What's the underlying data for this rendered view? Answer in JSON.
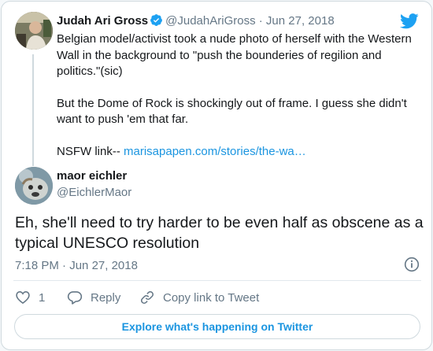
{
  "parent_tweet": {
    "author_name": "Judah Ari Gross",
    "handle": "@JudahAriGross",
    "separator": "·",
    "date": "Jun 27, 2018",
    "paragraphs": [
      "Belgian model/activist took a nude photo of herself with the Western Wall in the background to \"push the bounderies of regilion and politics.\"(sic)",
      "But the Dome of Rock is shockingly out of frame. I guess she didn't want to push 'em that far."
    ],
    "link_prefix": "NSFW link-- ",
    "link_text": "marisapapen.com/stories/the-wa…"
  },
  "tweet": {
    "author_name": "maor eichler",
    "handle": "@EichlerMaor",
    "text": "Eh, she'll need to try harder to be even half as obscene as a typical UNESCO resolution",
    "time": "7:18 PM",
    "separator": "·",
    "date": "Jun 27, 2018"
  },
  "actions": {
    "like_count": "1",
    "reply_label": "Reply",
    "copy_link_label": "Copy link to Tweet"
  },
  "explore_label": "Explore what's happening on Twitter",
  "colors": {
    "brand_blue": "#1da1f2",
    "link": "#1b95e0",
    "secondary_text": "#657786",
    "border": "#cfd9de"
  },
  "icons": {
    "brand": "twitter-bird-icon",
    "verified": "verified-badge-icon",
    "info": "info-icon",
    "like": "heart-icon",
    "reply": "reply-bubble-icon",
    "copy_link": "link-icon"
  }
}
